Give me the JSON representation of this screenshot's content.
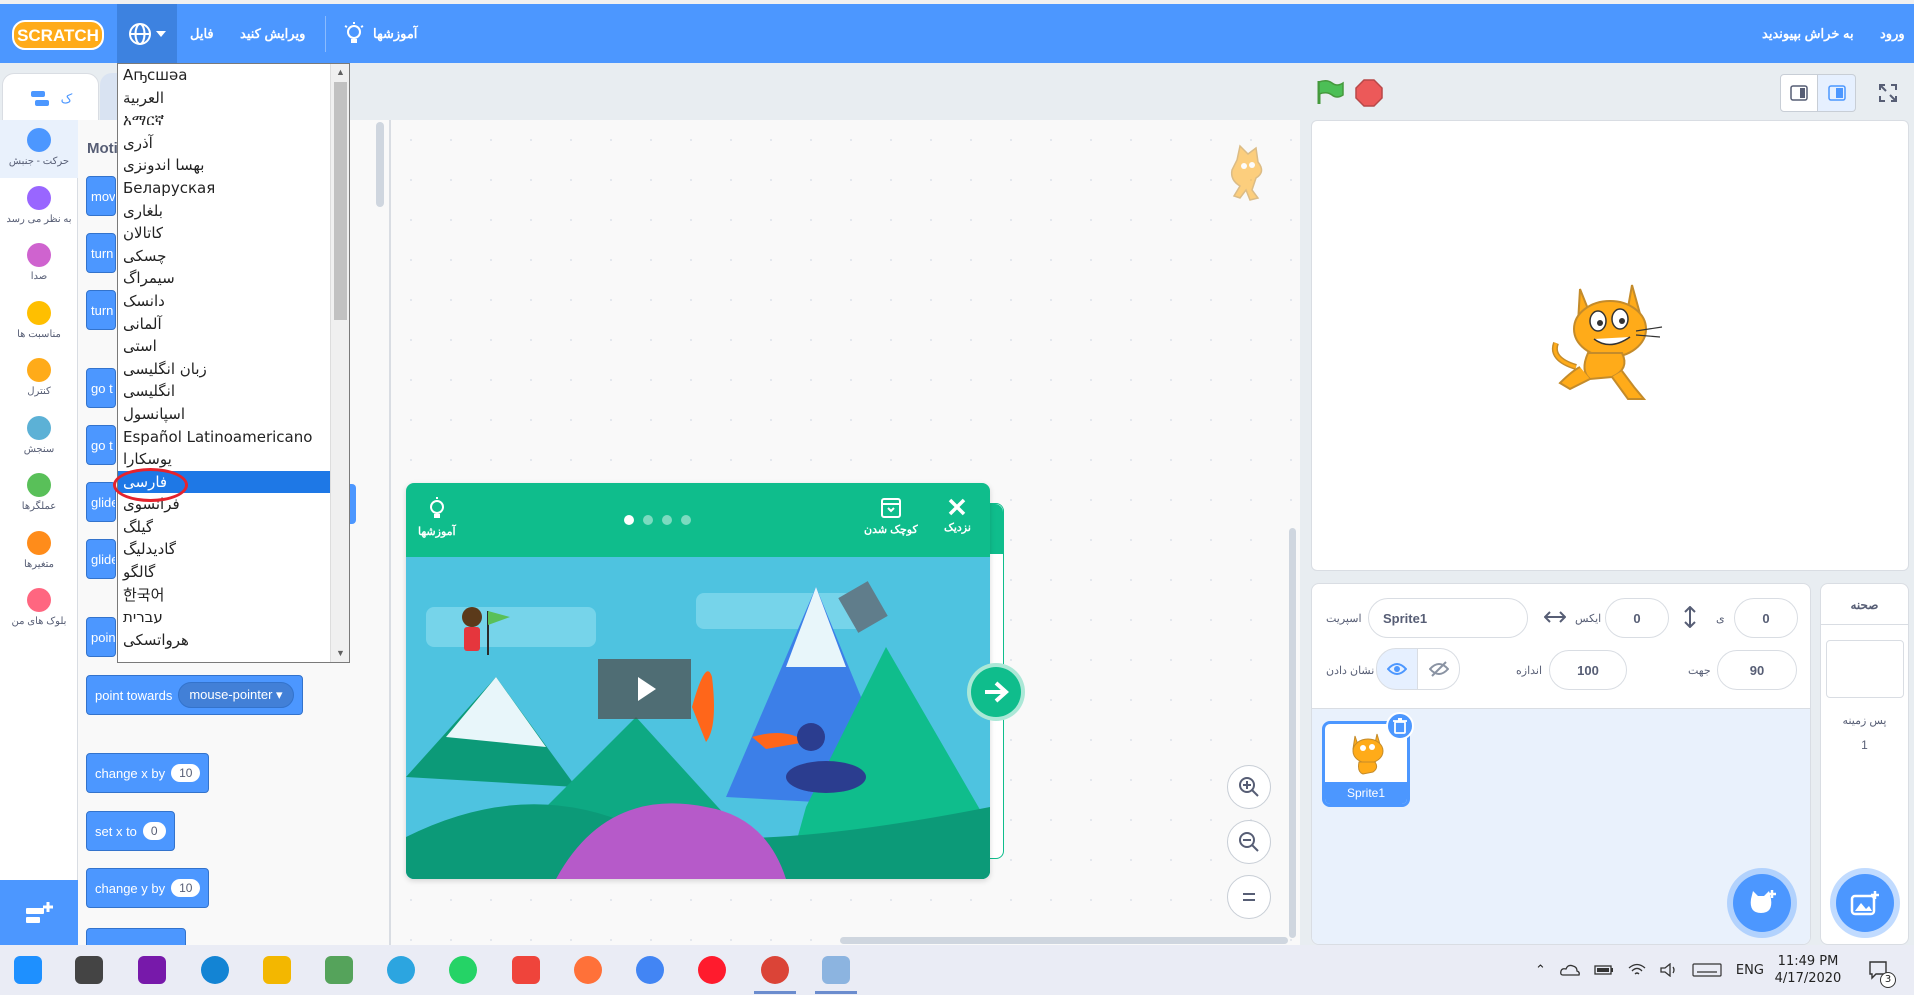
{
  "menubar": {
    "logo_text": "SCRATCH",
    "file_label": "فایل",
    "edit_label": "ویرایش کنید",
    "tutorials_label": "آموزشها",
    "join_label": "به خراش بپیوندید",
    "signin_label": "ورود",
    "colors": {
      "bar": "#4c97ff",
      "active": "#3d82e0"
    }
  },
  "language_dropdown": {
    "items": [
      "Аҧсшәа",
      "العربية",
      "አማርኛ",
      "آذری",
      "بهسا اندونزی",
      "Беларуская",
      "بلغاری",
      "کاتالان",
      "چسکی",
      "سیمراگ",
      "دانسک",
      "آلمانی",
      "استی",
      "زبان انگلیسی",
      "انگلیسی",
      "اسپانسول",
      "Español Latinoamericano",
      "یوسکارا",
      "فارسی",
      "فرانسوی",
      "گیلگ",
      "گادیدلیگ",
      "گالگو",
      "한국어",
      "עברית",
      "هرواتسکی"
    ],
    "selected_index": 18
  },
  "left_panel": {
    "code_tab_label": "ک",
    "section_title": "Moti",
    "categories": [
      {
        "label": "حرکت - جنبش",
        "color": "#4c97ff"
      },
      {
        "label": "به نظر می رسد",
        "color": "#9966ff"
      },
      {
        "label": "صدا",
        "color": "#cf63cf"
      },
      {
        "label": "مناسبت ها",
        "color": "#ffbf00"
      },
      {
        "label": "کنترل",
        "color": "#ffab19"
      },
      {
        "label": "سنجش",
        "color": "#5cb1d6"
      },
      {
        "label": "عملگرها",
        "color": "#59c059"
      },
      {
        "label": "متغیرها",
        "color": "#ff8c1a"
      },
      {
        "label": "بلوک های من",
        "color": "#ff6680"
      }
    ],
    "blocks": {
      "move": "mov",
      "turn1": "turn",
      "turn2": "turn",
      "goto1": "go t",
      "goto2": "go t",
      "glide1": "glide",
      "glide2": "glide",
      "point": "poin",
      "point_towards": "point towards",
      "point_towards_value": "mouse-pointer",
      "change_x": "change x by",
      "change_x_value": "10",
      "set_x": "set x to",
      "set_x_value": "0",
      "change_y": "change y by",
      "change_y_value": "10"
    }
  },
  "tutorial_card": {
    "close_label": "نزدیک",
    "shrink_label": "کوچک شدن",
    "tutorials_label": "آموزشها",
    "page_count": 4,
    "current_page": 1
  },
  "sprite_info": {
    "sprite_label": "اسپریت",
    "sprite_name": "Sprite1",
    "x_label": "ایکس",
    "x_value": "0",
    "y_label": "ی",
    "y_value": "0",
    "show_label": "نشان دادن",
    "size_label": "اندازه",
    "size_value": "100",
    "direction_label": "جهت",
    "direction_value": "90",
    "thumbnail_name": "Sprite1"
  },
  "stage_pane": {
    "title": "صحنه",
    "backdrops_label": "پس زمینه",
    "backdrops_count": "1"
  },
  "taskbar": {
    "language": "ENG",
    "time": "11:49 PM",
    "date": "4/17/2020",
    "notification_count": "3",
    "apps": [
      {
        "name": "windows",
        "color": "#1e90ff"
      },
      {
        "name": "taskview",
        "color": "#444444"
      },
      {
        "name": "onenote",
        "color": "#7719aa"
      },
      {
        "name": "edge",
        "color": "#1384d4"
      },
      {
        "name": "explorer",
        "color": "#f3b700"
      },
      {
        "name": "paint",
        "color": "#55a35b"
      },
      {
        "name": "telegram",
        "color": "#2ca5e0"
      },
      {
        "name": "whatsapp",
        "color": "#25d366"
      },
      {
        "name": "anydesk",
        "color": "#ef443b"
      },
      {
        "name": "firefox",
        "color": "#ff7139"
      },
      {
        "name": "chrome",
        "color": "#4285f4"
      },
      {
        "name": "opera",
        "color": "#ff1b2d"
      },
      {
        "name": "chrome-profile",
        "color": "#db4437"
      },
      {
        "name": "scratch-desktop",
        "color": "#8cb4e0"
      }
    ]
  }
}
